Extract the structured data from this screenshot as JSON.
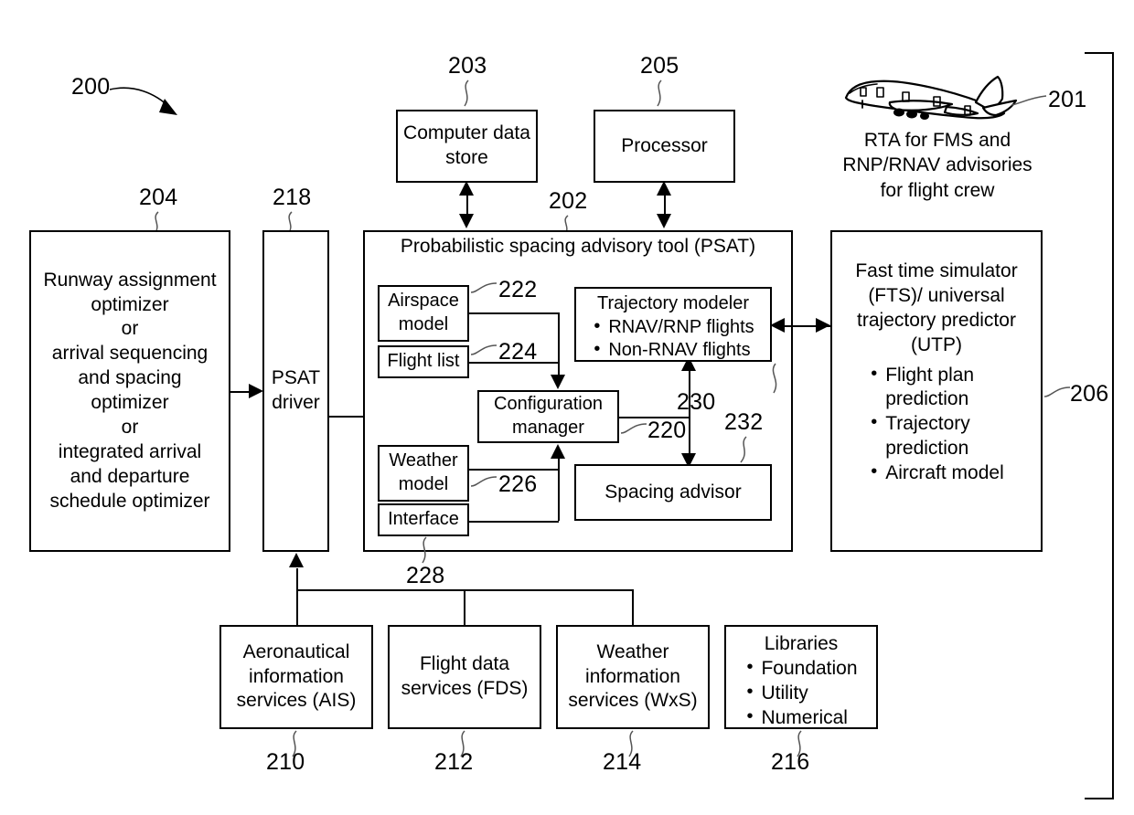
{
  "figure": {
    "figure_ref": "200",
    "refs": {
      "system": "200",
      "aircraft": "201",
      "psat": "202",
      "data_store": "203",
      "optimizer": "204",
      "processor": "205",
      "fts": "206",
      "ais": "210",
      "fds": "212",
      "wxs": "214",
      "libraries": "216",
      "psat_driver": "218",
      "configuration_manager": "220",
      "airspace_model": "222",
      "flight_list": "224",
      "weather_model": "226",
      "interface": "228",
      "trajectory_modeler": "230",
      "spacing_advisor": "232"
    }
  },
  "aircraft": {
    "icon": "airplane-icon",
    "caption_lines": [
      "RTA for FMS and",
      "RNP/RNAV advisories",
      "for flight crew"
    ]
  },
  "boxes": {
    "data_store": {
      "lines": [
        "Computer data",
        "store"
      ]
    },
    "processor": {
      "lines": [
        "Processor"
      ]
    },
    "optimizer": {
      "lines": [
        "Runway assignment",
        "optimizer",
        "or",
        "arrival sequencing",
        "and spacing",
        "optimizer",
        "or",
        "integrated arrival",
        "and departure",
        "schedule optimizer"
      ]
    },
    "psat_driver": {
      "lines": [
        "PSAT",
        "driver"
      ]
    },
    "psat": {
      "title": "Probabilistic spacing advisory tool (PSAT)",
      "airspace_model": {
        "lines": [
          "Airspace",
          "model"
        ]
      },
      "flight_list": {
        "lines": [
          "Flight list"
        ]
      },
      "weather_model": {
        "lines": [
          "Weather",
          "model"
        ]
      },
      "interface": {
        "lines": [
          "Interface"
        ]
      },
      "configuration_manager": {
        "lines": [
          "Configuration",
          "manager"
        ]
      },
      "trajectory_modeler": {
        "title": "Trajectory modeler",
        "bullets": [
          "RNAV/RNP flights",
          "Non-RNAV flights"
        ]
      },
      "spacing_advisor": {
        "lines": [
          "Spacing advisor"
        ]
      }
    },
    "fts": {
      "title_lines": [
        "Fast time simulator",
        "(FTS)/ universal",
        "trajectory predictor",
        "(UTP)"
      ],
      "bullets": [
        "Flight plan",
        "prediction",
        "Trajectory",
        "prediction",
        "Aircraft model"
      ],
      "bullet_items": [
        [
          "Flight plan",
          "prediction"
        ],
        [
          "Trajectory",
          "prediction"
        ],
        [
          "Aircraft model"
        ]
      ]
    },
    "ais": {
      "lines": [
        "Aeronautical",
        "information",
        "services (AIS)"
      ]
    },
    "fds": {
      "lines": [
        "Flight data",
        "services (FDS)"
      ]
    },
    "wxs": {
      "lines": [
        "Weather",
        "information",
        "services (WxS)"
      ]
    },
    "libraries": {
      "title": "Libraries",
      "bullets": [
        "Foundation",
        "Utility",
        "Numerical"
      ]
    }
  },
  "colors": {
    "stroke": "#000000",
    "background": "#ffffff"
  }
}
